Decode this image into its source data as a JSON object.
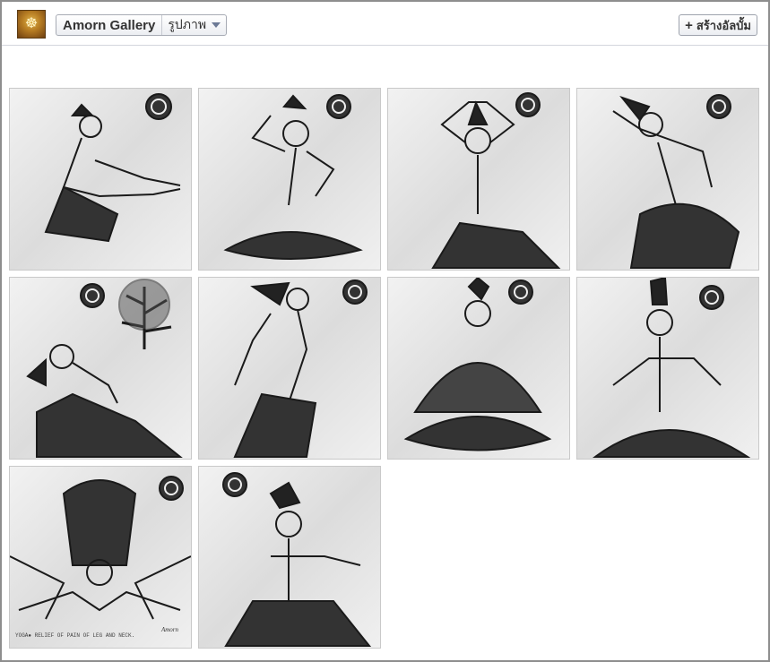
{
  "header": {
    "page_name": "Amorn Gallery",
    "section_label": "รูปภาพ",
    "create_album_label": "สร้างอัลบั้ม",
    "plus_glyph": "+"
  },
  "photos": [
    {
      "pose": "seated-forward-stretch"
    },
    {
      "pose": "crosslegged-hand-behind-head"
    },
    {
      "pose": "hands-overhead-lunge"
    },
    {
      "pose": "kneeling-side-bend"
    },
    {
      "pose": "kneeling-backbend-with-tree"
    },
    {
      "pose": "standing-backbend"
    },
    {
      "pose": "lotus-meditation"
    },
    {
      "pose": "seated-arms-crossed"
    },
    {
      "pose": "inverted-forward-fold",
      "caption": "YOGA● RELIEF OF PAIN OF LEG AND NECK.",
      "signature": "Amorn"
    },
    {
      "pose": "seated-arm-stretch"
    }
  ],
  "colors": {
    "ink": "#1a1a1a",
    "paper": "#e6e6e6",
    "border": "#8e8e8e"
  }
}
